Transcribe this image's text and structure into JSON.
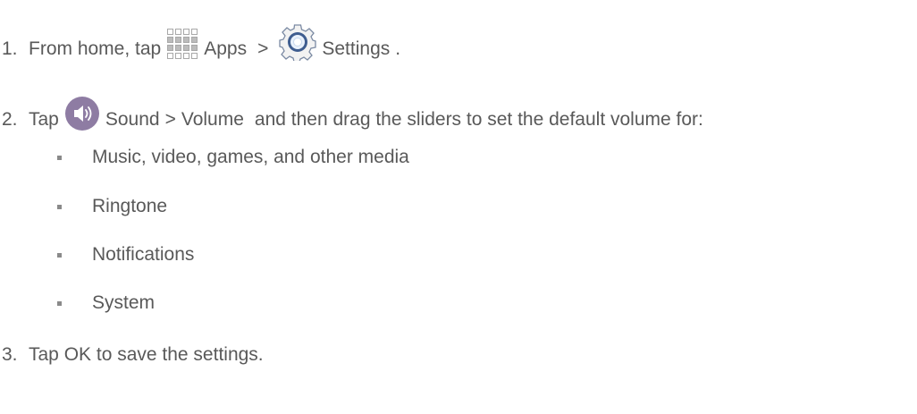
{
  "steps": [
    {
      "number": "1.",
      "text_a": "From home, tap",
      "icon_a": "apps-grid-icon",
      "text_b": "Apps",
      "separator": ">",
      "icon_b": "settings-gear-icon",
      "text_c": "Settings",
      "end": "."
    },
    {
      "number": "2.",
      "text_a": "Tap",
      "icon_a": "sound-speaker-icon",
      "text_b": "Sound",
      "separator": ">",
      "text_c": "Volume",
      "text_d": "and then drag the sliders to set the default volume for:",
      "bullets": [
        "Music, video, games, and other media",
        "Ringtone",
        "Notifications",
        "System"
      ]
    },
    {
      "number": "3.",
      "text_a": "Tap OK to save the settings."
    }
  ],
  "colors": {
    "text": "#595959",
    "sound_icon_bg": "#8e7ca3",
    "settings_ring": "#4a6a9a",
    "apps_grid": "#a8a8a8"
  }
}
